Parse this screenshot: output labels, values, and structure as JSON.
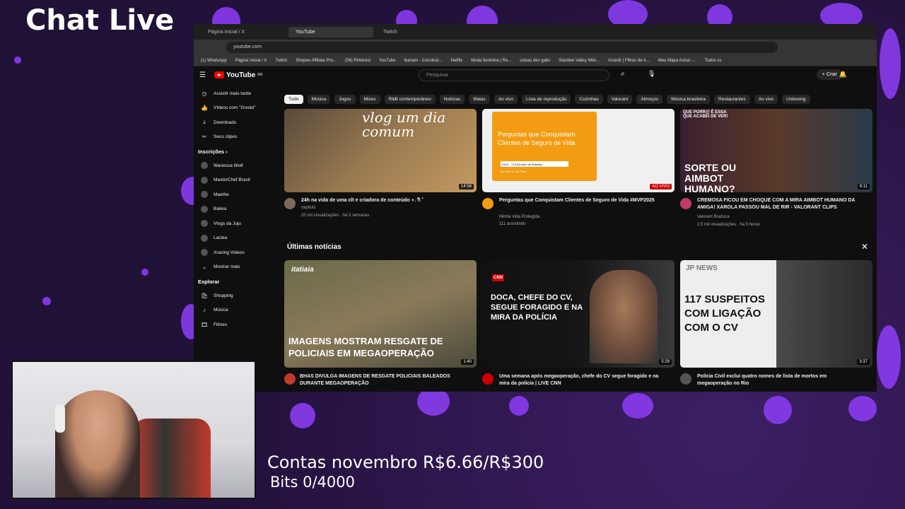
{
  "overlay": {
    "chat_title": "Chat Live",
    "goal_text": "Contas novembro R$6.66/R$300",
    "bits_text": "Bits 0/4000",
    "accent": "#8a3cf0"
  },
  "browser": {
    "tabs": [
      "Página Inicial / X",
      "YouTube",
      "Twitch"
    ],
    "address": "youtube.com",
    "bookmarks": [
      "(1) WhatsApp",
      "Página Inicial / X",
      "Twitch",
      "Shopee Affiliate Pro...",
      "(56) Pinterest",
      "YouTube",
      "Ikariam - Construir...",
      "Netflix",
      "Moda feminina | Ro...",
      "coisas dev gabs",
      "Stardew Valley Wiki...",
      "Assistir | Filhos de A...",
      "Meu Mapa Astral -...",
      "Todos os"
    ]
  },
  "youtube": {
    "logo": "YouTube",
    "logo_sup": "BR",
    "search_placeholder": "Pesquisar",
    "create_label": "Criar",
    "chips": [
      "Tudo",
      "Música",
      "Jogos",
      "Mixes",
      "R&B contemporâneo",
      "Notícias",
      "Malas",
      "Ao vivo",
      "Lista de reprodução",
      "Cozinhas",
      "Valorant",
      "Almoços",
      "Música brasileira",
      "Restaurantes",
      "Ao vivo",
      "Unboxing"
    ],
    "sidebar": {
      "top_items": [
        {
          "label": "Assistir mais tarde",
          "icon": "clock-icon"
        },
        {
          "label": "Vídeos com \"Gostei\"",
          "icon": "thumb-up-icon"
        },
        {
          "label": "Downloads",
          "icon": "download-icon"
        },
        {
          "label": "Seus clipes",
          "icon": "scissors-icon"
        }
      ],
      "subs_header": "Inscrições",
      "subs": [
        "Wanessa Wolf",
        "MasterChef Brasil",
        "Maethe",
        "Baleia",
        "Vlogs da Juju",
        "Lactea",
        "Xracing Videos",
        "Mostrar mais"
      ],
      "explore_header": "Explorar",
      "explore": [
        "Shopping",
        "Música",
        "Filmes"
      ]
    },
    "videos_top": [
      {
        "title": "24h na vida de uma clt e criadora de conteúdo ⋆. 𐙚 ˚",
        "channel": "capituts",
        "meta": "20 mil visualizações · há 3 semanas",
        "duration": "14:58",
        "thumb_text": "vlog um dia comum"
      },
      {
        "title": "Perguntas que Conquistam Clientes de Seguro de Vida #MVP2025",
        "channel": "Minha Vida Protegida",
        "meta": "111 assistindo",
        "duration": "AO VIVO",
        "thumb_text": "Perguntas que Conquistam Clientes de Seguro de Vida",
        "thumb_sub": "04/11 - 17h (Horário de Brasília)",
        "thumb_sub2": "Ao Vivo no YouTube"
      },
      {
        "title": "CREMOSA FICOU EM CHOQUE COM A MIRA AIMBOT HUMANO DA AMIGA! XAROLA PASSOU MAL DE RIR - VALORANT CLIPS",
        "channel": "Valorant Brazuca",
        "meta": "2,5 mil visualizações · há 5 horas",
        "duration": "8:11",
        "thumb_text": "SORTE OU AIMBOT HUMANO?",
        "thumb_top": "QUE PORR@ É ESSA QUE ACABEI DE VER!"
      }
    ],
    "news_section_title": "Últimas notícias",
    "videos_news": [
      {
        "title": "BHAS DIVULGA IMAGENS DE RESGATE POLICIAIS BALEADOS DURANTE MEGAOPERAÇÃO",
        "duration": "1:40",
        "thumb_text": "IMAGENS MOSTRAM RESGATE DE POLICIAIS EM MEGAOPERAÇÃO",
        "brand": "itatiaia"
      },
      {
        "title": "Uma semana após megaoperação, chefe do CV segue foragido e na mira da polícia | LIVE CNN",
        "duration": "5:29",
        "thumb_text": "DOCA, CHEFE DO CV, SEGUE FORAGIDO E NA MIRA DA POLÍCIA",
        "brand": "CNN"
      },
      {
        "title": "Polícia Civil exclui quatro nomes de lista de mortos em megaoperação no Rio",
        "duration": "3:37",
        "thumb_text": "117 SUSPEITOS COM LIGAÇÃO COM O CV",
        "brand": "JP NEWS"
      }
    ]
  }
}
